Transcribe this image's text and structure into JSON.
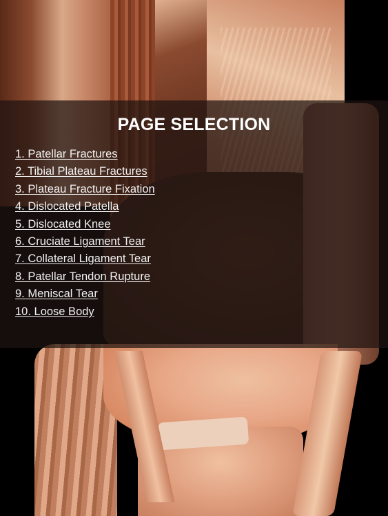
{
  "background": {
    "image_description": "Anatomical dissection photo of a knee joint on black background",
    "overlay_color": "#1e1410"
  },
  "page_selection": {
    "title": "PAGE SELECTION",
    "items": [
      {
        "label": "1. Patellar Fractures"
      },
      {
        "label": "2. Tibial Plateau Fractures"
      },
      {
        "label": "3. Plateau Fracture Fixation"
      },
      {
        "label": "4. Dislocated Patella"
      },
      {
        "label": "5. Dislocated Knee"
      },
      {
        "label": "6. Cruciate Ligament Tear"
      },
      {
        "label": "7. Collateral Ligament Tear"
      },
      {
        "label": "8. Patellar Tendon Rupture"
      },
      {
        "label": "9. Meniscal Tear"
      },
      {
        "label": "10. Loose Body"
      }
    ]
  }
}
